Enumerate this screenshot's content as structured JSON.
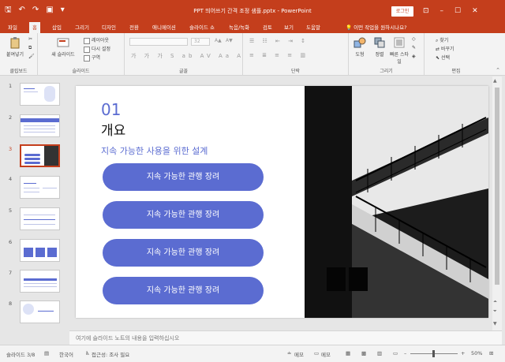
{
  "window": {
    "title": "PPT 띄어쓰기 간격 조정 샘플.pptx  -  PowerPoint",
    "login_label": "로그인",
    "qat_icons": [
      "save-icon",
      "undo-icon",
      "redo-icon",
      "present-icon",
      "customize-icon"
    ],
    "controls": [
      "ribbon-display-icon",
      "minimize-icon",
      "maximize-icon",
      "close-icon"
    ]
  },
  "tabs": [
    {
      "label": "파일",
      "active": false
    },
    {
      "label": "홈",
      "active": true
    },
    {
      "label": "삽입",
      "active": false
    },
    {
      "label": "그리기",
      "active": false
    },
    {
      "label": "디자인",
      "active": false
    },
    {
      "label": "전환",
      "active": false
    },
    {
      "label": "애니메이션",
      "active": false
    },
    {
      "label": "슬라이드 쇼",
      "active": false
    },
    {
      "label": "녹음/녹화",
      "active": false
    },
    {
      "label": "검토",
      "active": false
    },
    {
      "label": "보기",
      "active": false
    },
    {
      "label": "도움말",
      "active": false
    }
  ],
  "tell_me": "이떤 작업을 원하시나요?",
  "ribbon": {
    "clipboard": {
      "paste": "붙여넣기",
      "label": "클립보드"
    },
    "slides": {
      "new_slide": "새 슬라이드",
      "layout": "레이아웃",
      "reset": "다시 설정",
      "section": "구역",
      "label": "슬라이드"
    },
    "font": {
      "label": "글꼴",
      "size_value": "32"
    },
    "paragraph": {
      "label": "단락"
    },
    "drawing": {
      "shape": "도형",
      "arrange": "정렬",
      "quick_styles": "빠른 스타일",
      "label": "그리기"
    },
    "editing": {
      "find": "찾기",
      "replace": "바꾸기",
      "select": "선택",
      "label": "편집"
    }
  },
  "thumbnails": [
    "1",
    "2",
    "3",
    "4",
    "5",
    "6",
    "7",
    "8"
  ],
  "active_slide": 3,
  "slide": {
    "number": "01",
    "title": "개요",
    "subtitle": "지속 가능한 사용을 위한 설계",
    "pills": [
      "지속 가능한 관행 장려",
      "지속 가능한 관행 장려",
      "지속 가능한 관행 장려",
      "지속  가능한  관행  장려"
    ]
  },
  "notes_placeholder": "여기에 슬라이드 노트의 내용을 입력하십시오",
  "status": {
    "slide_count": "슬라이드 3/8",
    "language": "한국어",
    "accessibility": "접근성: 조사 필요",
    "notes": "메모",
    "comments": "메모",
    "zoom": "50%"
  },
  "colors": {
    "accent": "#c43e1c",
    "pill": "#5b6cd1"
  }
}
